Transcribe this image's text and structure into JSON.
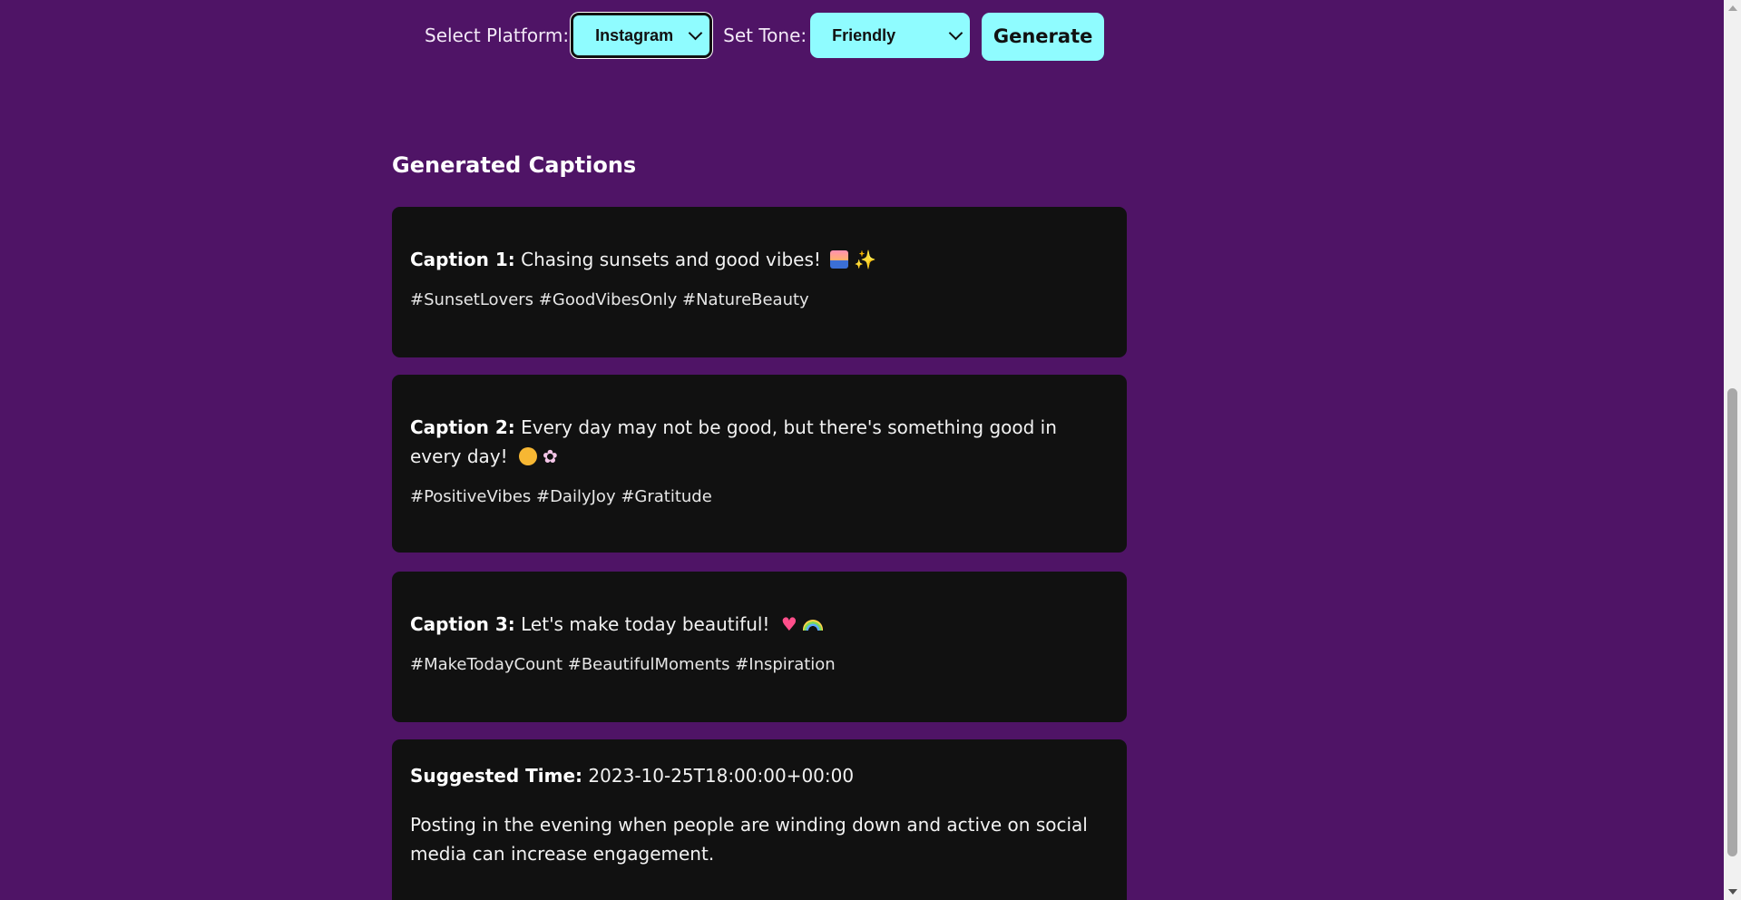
{
  "controls": {
    "platform_label": "Select Platform:",
    "platform_value": "Instagram",
    "tone_label": "Set Tone:",
    "tone_value": "Friendly",
    "generate_label": "Generate"
  },
  "results": {
    "title": "Generated Captions",
    "captions": [
      {
        "label": "Caption 1:",
        "text": "Chasing sunsets and good vibes!",
        "emojis": [
          "sunset-emoji-icon",
          "sparkles-emoji-icon"
        ],
        "hashtags": "#SunsetLovers #GoodVibesOnly #NatureBeauty"
      },
      {
        "label": "Caption 2:",
        "text": "Every day may not be good, but there's something good in every day!",
        "emojis": [
          "smiling-face-emoji-icon",
          "blossom-emoji-icon"
        ],
        "hashtags": "#PositiveVibes #DailyJoy #Gratitude"
      },
      {
        "label": "Caption 3:",
        "text": "Let's make today beautiful!",
        "emojis": [
          "sparkling-heart-emoji-icon",
          "rainbow-emoji-icon"
        ],
        "hashtags": "#MakeTodayCount #BeautifulMoments #Inspiration"
      }
    ],
    "suggested_time": {
      "label": "Suggested Time:",
      "value": "2023-10-25T18:00:00+00:00",
      "reason": "Posting in the evening when people are winding down and active on social media can increase engagement."
    }
  },
  "colors": {
    "background": "#4f1466",
    "accent": "#8ffcff",
    "card": "#111111"
  }
}
